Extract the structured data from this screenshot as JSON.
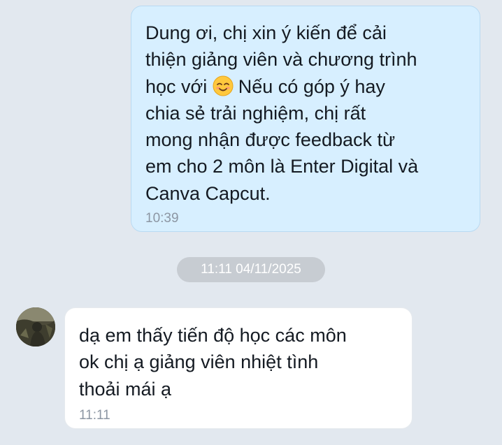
{
  "outgoing_message": {
    "lines": [
      "Dung ơi, chị xin ý kiến để cải",
      "thiện giảng viên và chương trình",
      "Nếu có góp ý hay",
      "chia sẻ trải nghiệm, chị rất",
      "mong nhận được feedback từ",
      "em cho 2 môn là Enter Digital và",
      "Canva Capcut."
    ],
    "line3_prefix": "học với",
    "emoji": "smiling-face-emoji",
    "time": "10:39"
  },
  "date_separator": "11:11 04/11/2025",
  "incoming_message": {
    "lines": [
      "dạ em thấy tiến độ học các môn",
      "ok chị ạ giảng viên nhiệt tình",
      "thoải mái ạ"
    ],
    "time": "11:11"
  },
  "colors": {
    "background": "#e2e8ef",
    "outgoing_bubble": "#d7efff",
    "incoming_bubble": "#ffffff",
    "date_pill": "#c7ccd2"
  }
}
